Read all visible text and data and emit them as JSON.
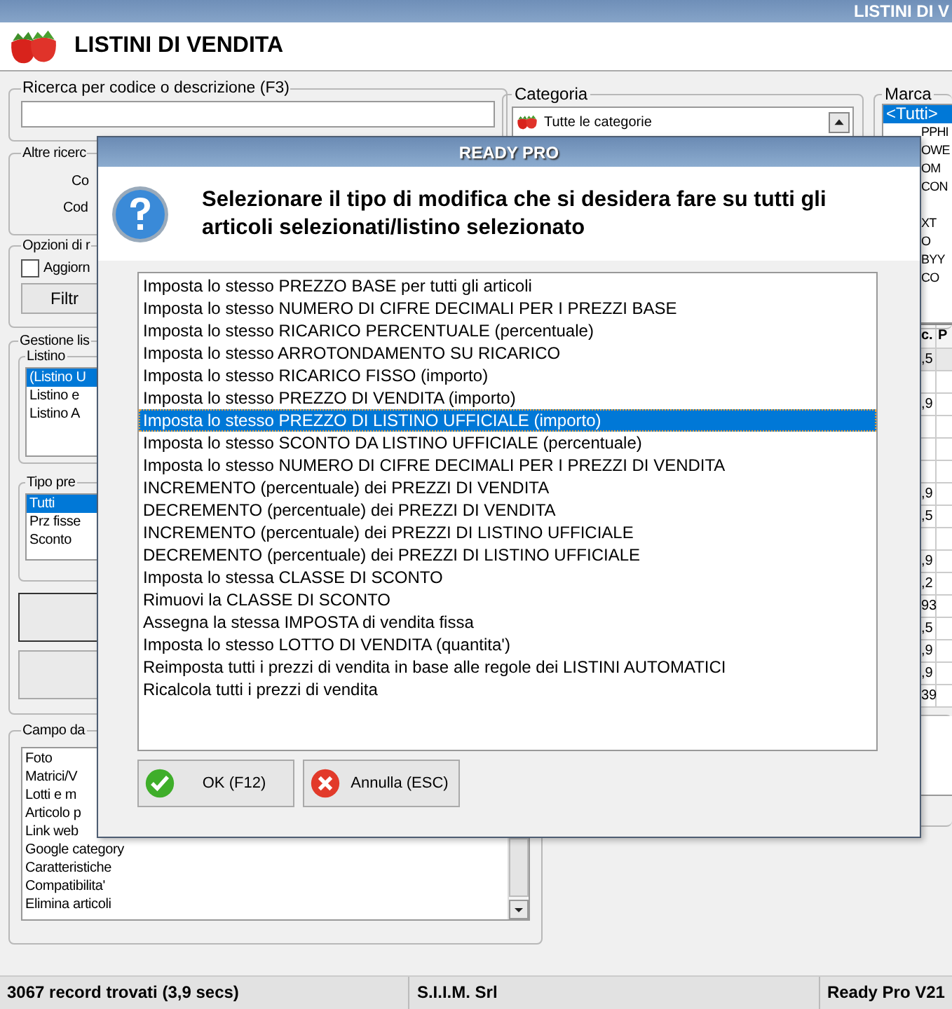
{
  "window": {
    "title": "LISTINI DI V"
  },
  "header": {
    "title": "LISTINI DI VENDITA"
  },
  "search": {
    "label": "Ricerca per codice o descrizione (F3)"
  },
  "other_searches": {
    "label": "Altre ricerc",
    "fields": [
      "Co",
      "Cod"
    ]
  },
  "options": {
    "label": "Opzioni di r",
    "checkbox": {
      "label": "Aggiorn",
      "checked": false
    },
    "button": "Filtr"
  },
  "price_list_management": {
    "label": "Gestione lis",
    "listino": {
      "label": "Listino",
      "items": [
        {
          "label": "(Listino U",
          "selected": true
        },
        {
          "label": "Listino e",
          "selected": false
        },
        {
          "label": "Listino A",
          "selected": false
        }
      ]
    },
    "price_type": {
      "label": "Tipo pre",
      "items": [
        {
          "label": "Tutti",
          "selected": true
        },
        {
          "label": "Prz fisse",
          "selected": false
        },
        {
          "label": "Sconto",
          "selected": false
        }
      ]
    }
  },
  "field_group": {
    "label": "Campo da",
    "items": [
      "Foto",
      "Matrici/V",
      "Lotti e m",
      "Articolo p",
      "Link web",
      "Google category",
      "Caratteristiche",
      "Compatibilita'",
      "Elimina articoli"
    ]
  },
  "category": {
    "label": "Categoria",
    "value": "Tutte le categorie"
  },
  "brand": {
    "label": "Marca",
    "items": [
      {
        "label": "<Tutti>",
        "selected": true
      },
      {
        "label": "PPHI",
        "selected": false
      },
      {
        "label": "OWE",
        "selected": false
      },
      {
        "label": "OM",
        "selected": false
      },
      {
        "label": "CON",
        "selected": false
      },
      {
        "selected": false
      },
      {
        "label": "XT",
        "selected": false
      },
      {
        "label": "O",
        "selected": false
      },
      {
        "label": "BYY",
        "selected": false
      },
      {
        "label": "CO",
        "selected": false
      }
    ]
  },
  "table": {
    "columns": [
      "c.",
      "P"
    ],
    "rows": [
      {
        "column_1": ",5"
      },
      {},
      {
        "column_1": ",9"
      },
      {},
      {},
      {},
      {
        "column_1": ",9"
      },
      {
        "column_1": ",5"
      },
      {},
      {
        "column_1": ",9"
      },
      {
        "column_1": ",2"
      },
      {
        "column_1": "93"
      },
      {
        "column_1": ",5"
      },
      {
        "column_1": ",9"
      },
      {
        "column_1": ",9"
      },
      {
        "column_1": "39"
      }
    ]
  },
  "dialog": {
    "title": "READY PRO",
    "message": "Selezionare il tipo di modifica che si desidera fare su tutti gli articoli selezionati/listino selezionato",
    "options": [
      {
        "label": "Imposta lo stesso PREZZO BASE per tutti gli articoli",
        "selected": false
      },
      {
        "label": "Imposta lo stesso NUMERO DI CIFRE DECIMALI PER I PREZZI BASE",
        "selected": false
      },
      {
        "label": "Imposta lo stesso RICARICO PERCENTUALE (percentuale)",
        "selected": false
      },
      {
        "label": "Imposta lo stesso ARROTONDAMENTO SU RICARICO",
        "selected": false
      },
      {
        "label": "Imposta lo stesso RICARICO FISSO (importo)",
        "selected": false
      },
      {
        "label": "Imposta lo stesso PREZZO DI VENDITA (importo)",
        "selected": false
      },
      {
        "label": "Imposta lo stesso PREZZO DI LISTINO UFFICIALE (importo)",
        "selected": true
      },
      {
        "label": "Imposta lo stesso SCONTO DA LISTINO UFFICIALE (percentuale)",
        "selected": false
      },
      {
        "label": "Imposta lo stesso NUMERO DI CIFRE DECIMALI PER I PREZZI DI VENDITA",
        "selected": false
      },
      {
        "label": "INCREMENTO (percentuale) dei PREZZI DI VENDITA",
        "selected": false
      },
      {
        "label": "DECREMENTO (percentuale) dei PREZZI DI VENDITA",
        "selected": false
      },
      {
        "label": "INCREMENTO (percentuale) dei PREZZI DI LISTINO UFFICIALE",
        "selected": false
      },
      {
        "label": "DECREMENTO (percentuale) dei PREZZI DI LISTINO UFFICIALE",
        "selected": false
      },
      {
        "label": "Imposta lo stessa CLASSE DI SCONTO",
        "selected": false
      },
      {
        "label": "Rimuovi la CLASSE DI SCONTO",
        "selected": false
      },
      {
        "label": "Assegna la stessa IMPOSTA di vendita fissa",
        "selected": false
      },
      {
        "label": "Imposta lo stesso LOTTO DI VENDITA (quantita')",
        "selected": false
      },
      {
        "label": "Reimposta tutti i prezzi di vendita in base alle regole dei LISTINI AUTOMATICI",
        "selected": false
      },
      {
        "label": "Ricalcola tutti i prezzi di vendita",
        "selected": false
      }
    ],
    "buttons": [
      {
        "kind": "ok",
        "label": "OK (F12)"
      },
      {
        "kind": "cancel",
        "label": "Annulla (ESC)"
      }
    ]
  },
  "status_bar": [
    "3067 record trovati (3,9 secs)",
    "S.I.I.M. Srl",
    "Ready Pro V21"
  ]
}
